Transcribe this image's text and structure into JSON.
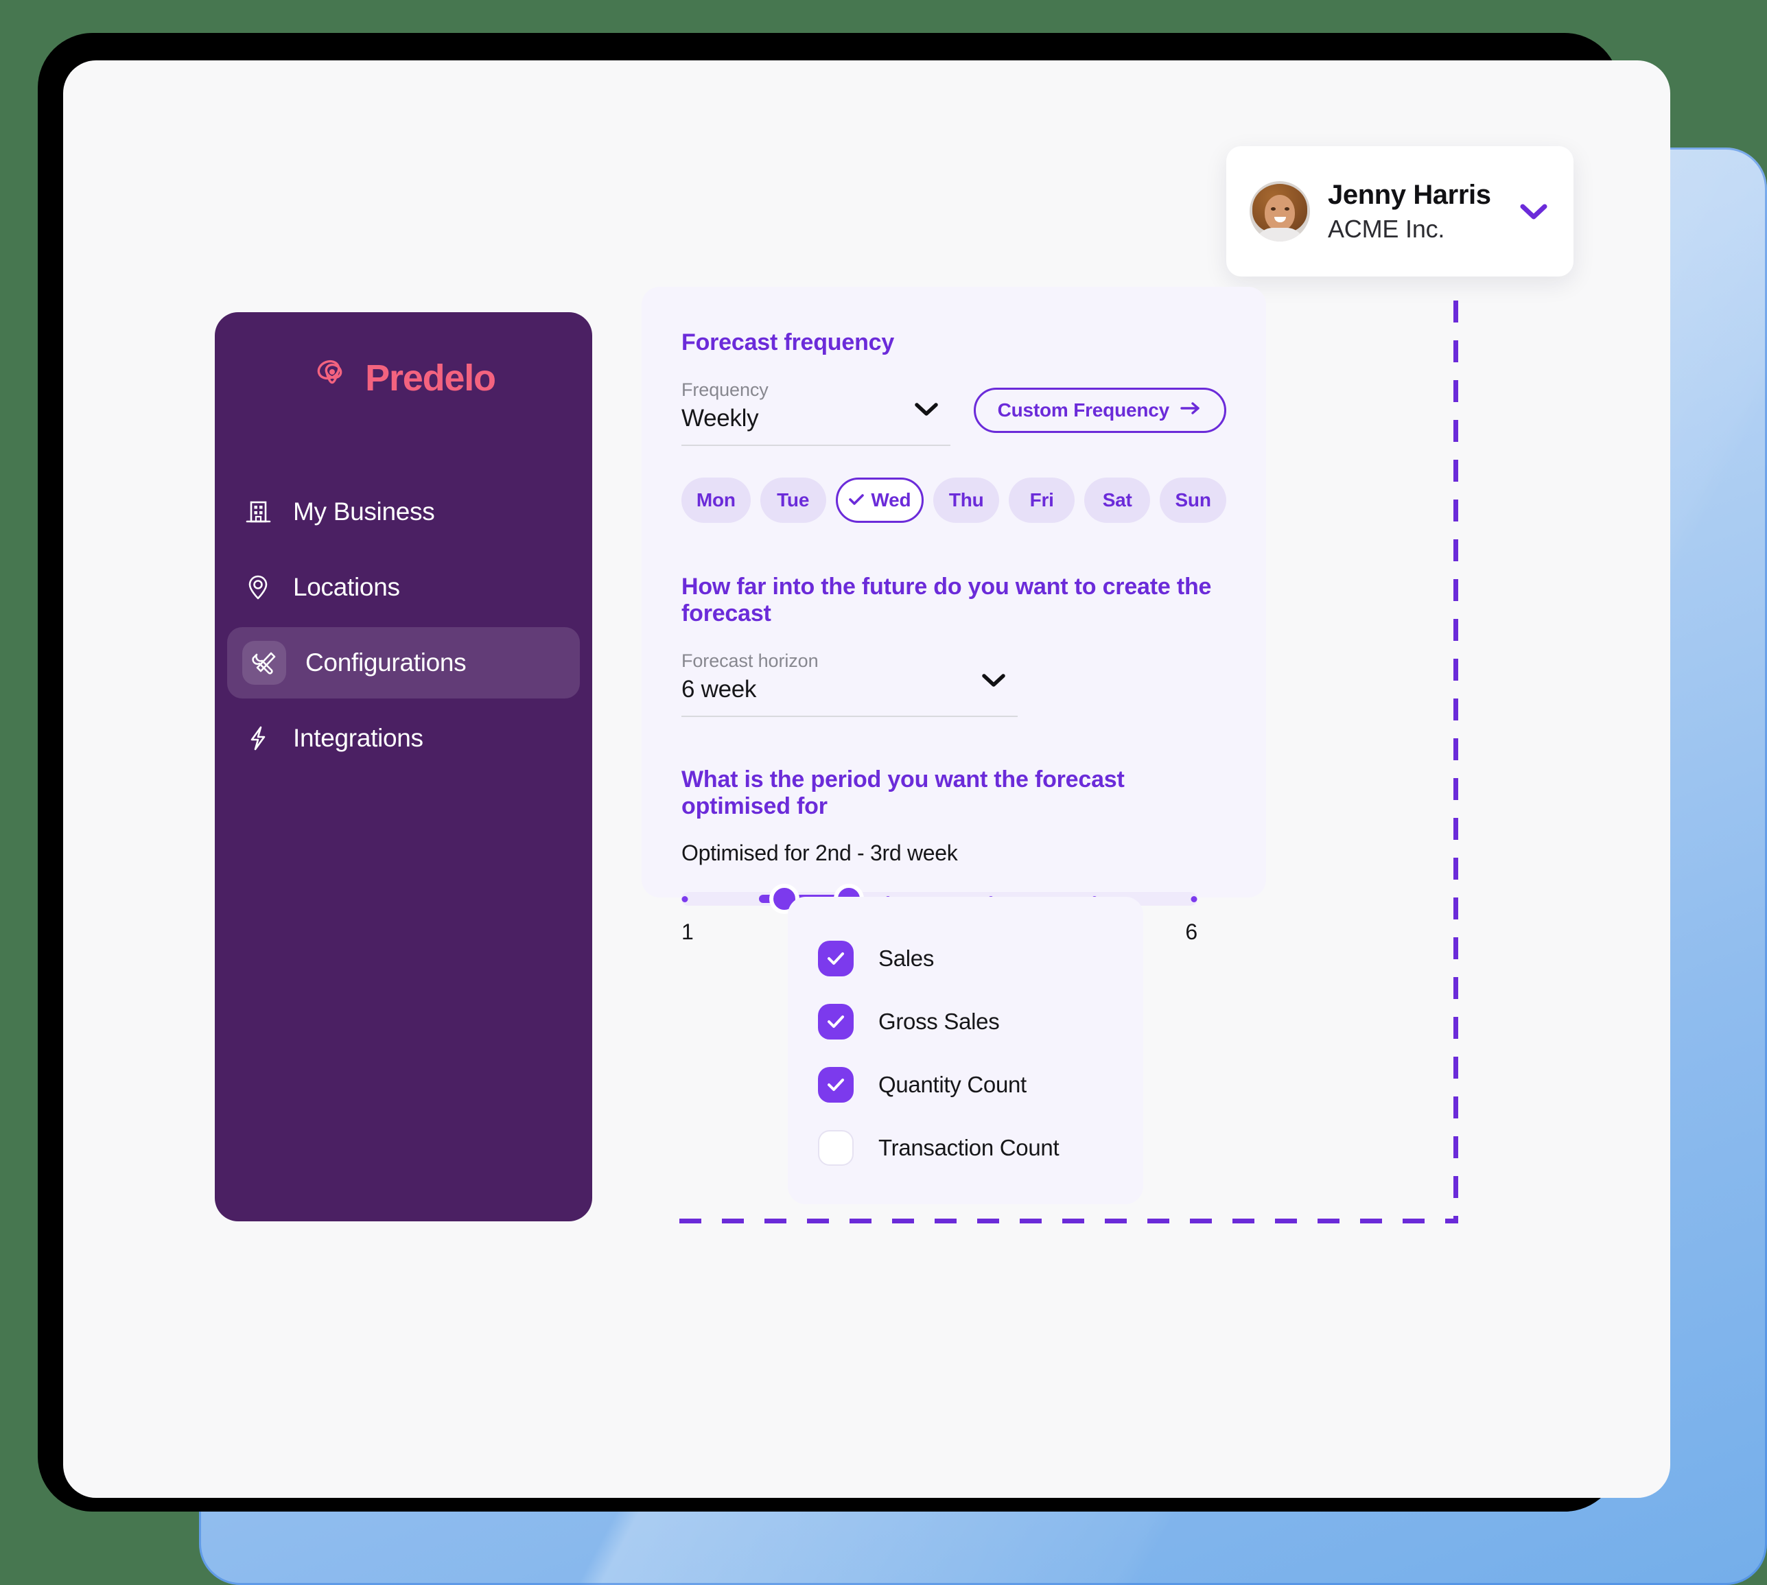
{
  "colors": {
    "page_background": "#477750",
    "device_bezel": "#000000",
    "app_background": "#f8f8f9",
    "sidebar": "#4b2063",
    "brand_pink": "#f4637f",
    "accent_purple": "#6b2bd9",
    "slider_purple": "#7c3aed",
    "card_lavender": "#f6f4fd",
    "pill_lavender": "#e7e0f8",
    "blue_card": "#8fbcee"
  },
  "profile": {
    "name": "Jenny Harris",
    "organization": "ACME Inc.",
    "avatar_icon": "user-avatar",
    "chevron_icon": "chevron-down-icon"
  },
  "sidebar": {
    "brand_name": "Predelo",
    "brand_logo_icon": "predelo-atom-logo",
    "items": [
      {
        "label": "My Business",
        "icon": "building-icon",
        "active": false
      },
      {
        "label": "Locations",
        "icon": "location-pin-icon",
        "active": false
      },
      {
        "label": "Configurations",
        "icon": "tools-wrench-screwdriver-icon",
        "active": true
      },
      {
        "label": "Integrations",
        "icon": "lightning-bolt-icon",
        "active": false
      }
    ]
  },
  "settings": {
    "frequency_section": {
      "title": "Forecast frequency",
      "field_label": "Frequency",
      "field_value": "Weekly",
      "chevron_icon": "chevron-down-icon",
      "custom_button_label": "Custom Frequency",
      "custom_button_icon": "arrow-right-icon",
      "days": [
        {
          "label": "Mon",
          "selected": false
        },
        {
          "label": "Tue",
          "selected": false
        },
        {
          "label": "Wed",
          "selected": true
        },
        {
          "label": "Thu",
          "selected": false
        },
        {
          "label": "Fri",
          "selected": false
        },
        {
          "label": "Sat",
          "selected": false
        },
        {
          "label": "Sun",
          "selected": false
        }
      ],
      "selected_day_check_icon": "check-icon"
    },
    "horizon_section": {
      "title": "How far into the future do you want to create the forecast",
      "field_label": "Forecast horizon",
      "field_value": "6 week",
      "chevron_icon": "chevron-down-icon"
    },
    "optimise_section": {
      "title": "What is the period you want the forecast optimised for",
      "caption": "Optimised for 2nd - 3rd week",
      "slider_min_label": "1",
      "slider_max_label": "6",
      "slider_min": 1,
      "slider_max": 6,
      "slider_value_low": 2,
      "slider_value_high": 3,
      "tick_count": 6
    }
  },
  "metrics": {
    "items": [
      {
        "label": "Sales",
        "checked": true
      },
      {
        "label": "Gross Sales",
        "checked": true
      },
      {
        "label": "Quantity Count",
        "checked": true
      },
      {
        "label": "Transaction Count",
        "checked": false
      }
    ],
    "check_icon": "check-icon"
  }
}
